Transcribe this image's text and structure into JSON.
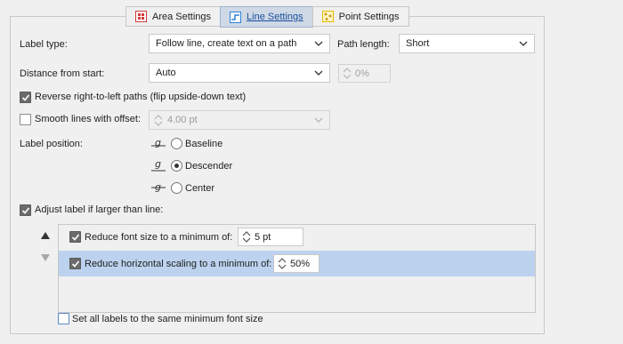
{
  "tabs": [
    {
      "label": "Area Settings",
      "icon": "area-settings-icon",
      "color": "#d33b3b"
    },
    {
      "label": "Line Settings",
      "icon": "line-settings-icon",
      "color": "#2f7fd6",
      "active": true
    },
    {
      "label": "Point Settings",
      "icon": "point-settings-icon",
      "color": "#e8b90b"
    }
  ],
  "label_type": {
    "label": "Label type:",
    "value": "Follow line, create text on a path"
  },
  "path_length": {
    "label": "Path length:",
    "value": "Short"
  },
  "distance": {
    "label": "Distance from start:",
    "value": "Auto",
    "percent": "0%"
  },
  "reverse_paths": {
    "label": "Reverse right-to-left paths (flip upside-down text)",
    "checked": true
  },
  "smooth_lines": {
    "label": "Smooth lines with offset:",
    "checked": false,
    "value": "4.00 pt"
  },
  "label_position": {
    "label": "Label position:",
    "options": [
      {
        "label": "Baseline",
        "glyph": "g",
        "checked": false
      },
      {
        "label": "Descender",
        "glyph": "g",
        "checked": true
      },
      {
        "label": "Center",
        "glyph": "g",
        "checked": false
      }
    ]
  },
  "adjust_label": {
    "label": "Adjust label if larger than line:",
    "checked": true
  },
  "adjust_items": [
    {
      "label": "Reduce font size to a minimum of:",
      "value": "5 pt",
      "checked": true
    },
    {
      "label": "Reduce horizontal scaling to a minimum of:",
      "value": "50%",
      "checked": true
    }
  ],
  "same_min_font": {
    "label": "Set all labels to the same minimum font size",
    "checked": false
  },
  "colors": {
    "accent": "#2f7fd6",
    "selection": "#bcd2ee"
  }
}
